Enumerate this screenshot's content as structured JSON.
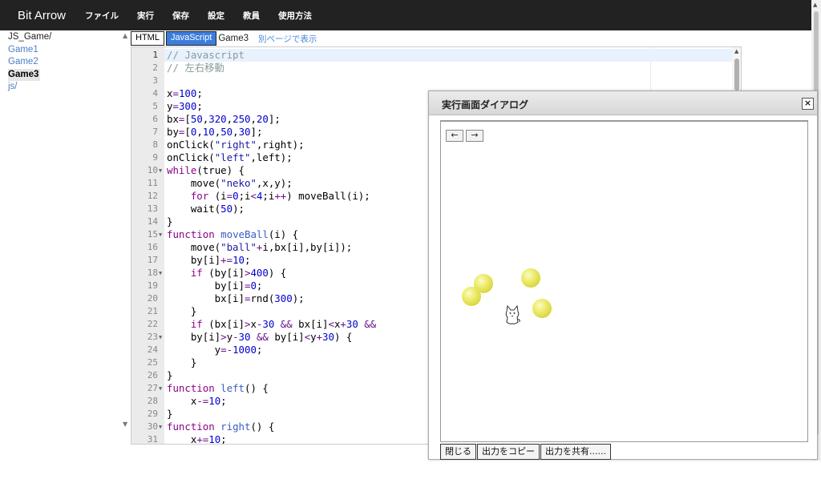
{
  "navbar": {
    "brand": "Bit Arrow",
    "items": [
      "ファイル",
      "実行",
      "保存",
      "設定",
      "教員",
      "使用方法"
    ]
  },
  "filetree": {
    "items": [
      {
        "label": "JS_Game/",
        "kind": "root"
      },
      {
        "label": "Game1",
        "kind": "link"
      },
      {
        "label": "Game2",
        "kind": "link"
      },
      {
        "label": "Game3",
        "kind": "active"
      },
      {
        "label": "js/",
        "kind": "link"
      }
    ]
  },
  "tabs": {
    "html_label": "HTML",
    "js_label": "JavaScript",
    "file_label": "Game3",
    "open_link": "別ページで表示"
  },
  "editor": {
    "lines": [
      "// Javascript",
      "// 左右移動",
      "",
      "x=100;",
      "y=300;",
      "bx=[50,320,250,20];",
      "by=[0,10,50,30];",
      "onClick(\"right\",right);",
      "onClick(\"left\",left);",
      "while(true) {",
      "    move(\"neko\",x,y);",
      "    for (i=0;i<4;i++) moveBall(i);",
      "    wait(50);",
      "}",
      "function moveBall(i) {",
      "    move(\"ball\"+i,bx[i],by[i]);",
      "    by[i]+=10;",
      "    if (by[i]>400) {",
      "        by[i]=0;",
      "        bx[i]=rnd(300);",
      "    }",
      "    if (bx[i]>x-30 && bx[i]<x+30 &&",
      "    by[i]>y-30 && by[i]<y+30) {",
      "        y=-1000;",
      "    }",
      "}",
      "function left() {",
      "    x-=10;",
      "}",
      "function right() {",
      "    x+=10;"
    ],
    "fold_lines": [
      10,
      15,
      18,
      23,
      27,
      30
    ]
  },
  "dialog": {
    "title": "実行画面ダイアログ",
    "close_label": "×",
    "left_arrow": "←",
    "right_arrow": "→",
    "buttons": [
      "閉じる",
      "出力をコピー",
      "出力を共有......"
    ]
  }
}
